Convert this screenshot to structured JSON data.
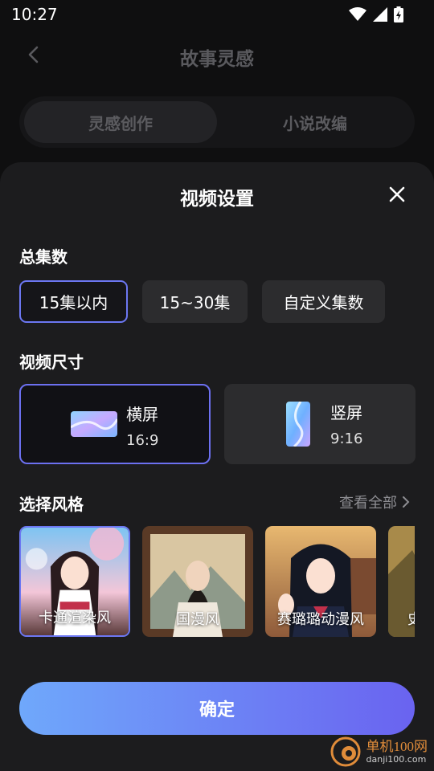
{
  "status_bar": {
    "time": "10:27",
    "icons": [
      "wifi-icon",
      "signal-icon",
      "battery-charging-icon"
    ]
  },
  "background_page": {
    "title": "故事灵感",
    "tabs": [
      {
        "label": "灵感创作",
        "active": true
      },
      {
        "label": "小说改编",
        "active": false
      }
    ]
  },
  "sheet": {
    "title": "视频设置",
    "episodes": {
      "title": "总集数",
      "options": [
        {
          "label": "15集以内",
          "selected": true
        },
        {
          "label": "15~30集",
          "selected": false
        },
        {
          "label": "自定义集数",
          "selected": false
        }
      ]
    },
    "video_size": {
      "title": "视频尺寸",
      "options": [
        {
          "name": "横屏",
          "ratio": "16:9",
          "selected": true
        },
        {
          "name": "竖屏",
          "ratio": "9:16",
          "selected": false
        }
      ]
    },
    "style": {
      "title": "选择风格",
      "see_all": "查看全部",
      "options": [
        {
          "label": "卡通渲染风",
          "selected": true
        },
        {
          "label": "国漫风",
          "selected": false
        },
        {
          "label": "赛璐璐动漫风",
          "selected": false
        },
        {
          "label": "史",
          "selected": false
        }
      ]
    },
    "confirm_label": "确定"
  },
  "watermark": {
    "text": "单机100网",
    "sub": "danji100.com"
  },
  "colors": {
    "accent": "#6c77f2",
    "button_gradient_start": "#6fa8fb",
    "button_gradient_end": "#6a63f0",
    "sheet_bg": "#1c1c1e",
    "chip_bg": "#2c2c2e"
  }
}
